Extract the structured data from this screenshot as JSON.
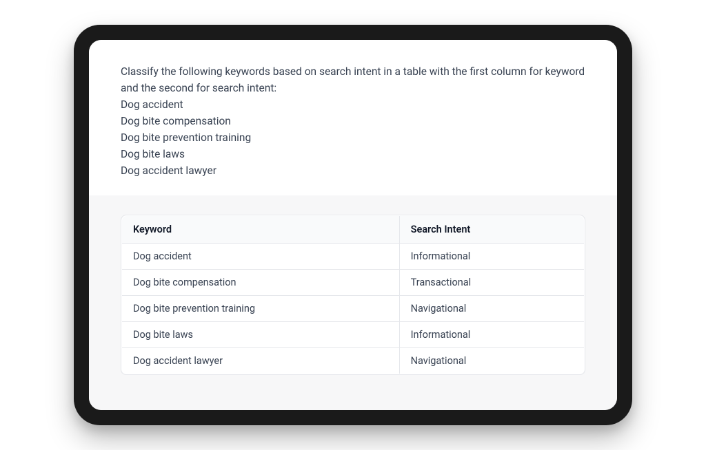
{
  "prompt": {
    "instruction": "Classify the following keywords based on search intent in a table with the first column for keyword and the second for search intent:",
    "keywords": [
      "Dog accident",
      "Dog bite compensation",
      "Dog bite prevention training",
      "Dog bite laws",
      "Dog accident lawyer"
    ]
  },
  "table": {
    "headers": {
      "keyword": "Keyword",
      "intent": "Search Intent"
    },
    "rows": [
      {
        "keyword": "Dog accident",
        "intent": "Informational"
      },
      {
        "keyword": "Dog bite compensation",
        "intent": "Transactional"
      },
      {
        "keyword": "Dog bite prevention training",
        "intent": "Navigational"
      },
      {
        "keyword": "Dog bite laws",
        "intent": "Informational"
      },
      {
        "keyword": "Dog accident lawyer",
        "intent": "Navigational"
      }
    ]
  }
}
